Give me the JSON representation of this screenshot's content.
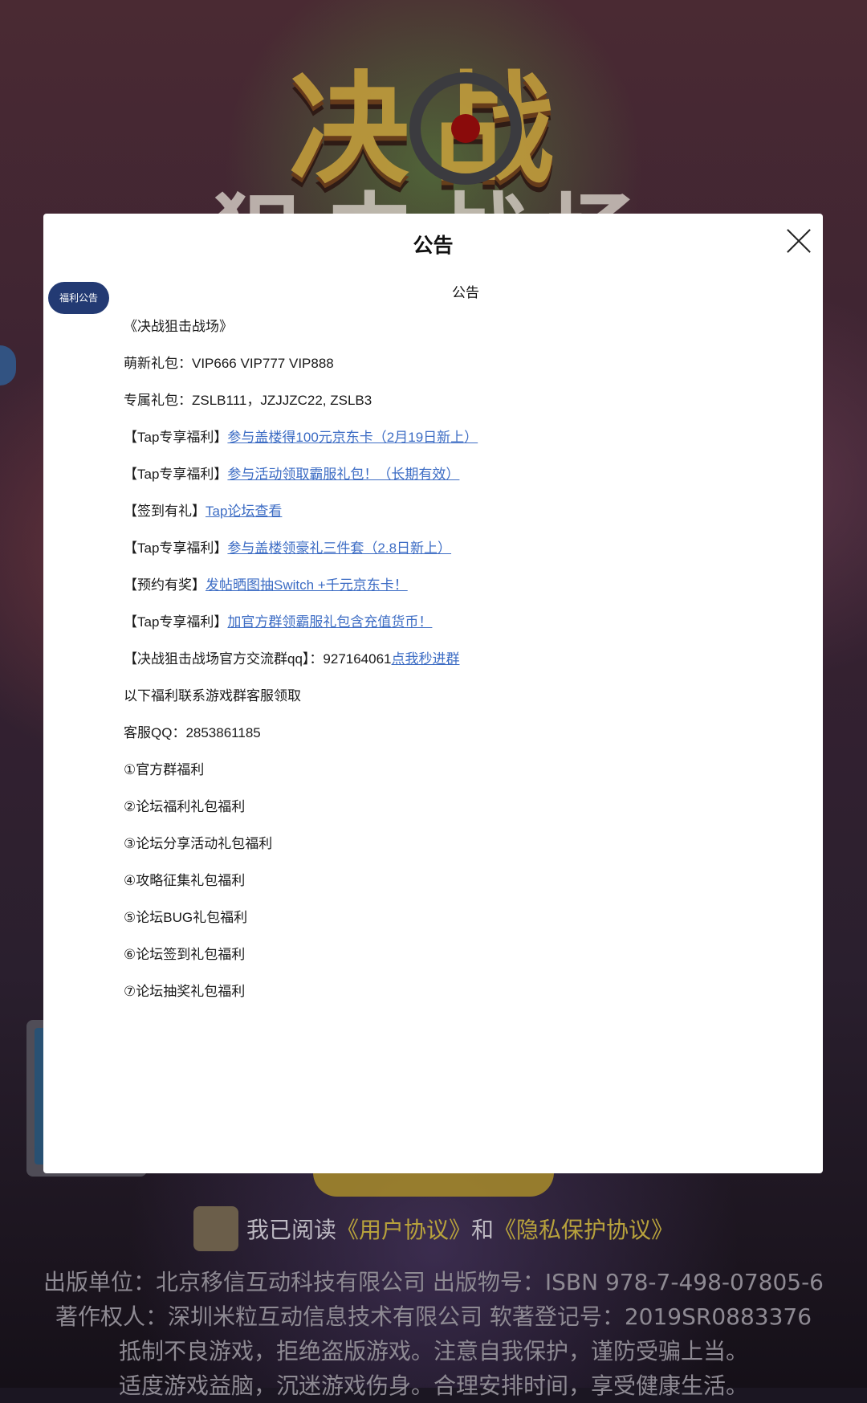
{
  "background": {
    "game_title_top": "决战",
    "game_title_bottom": "狙击战场"
  },
  "modal": {
    "title": "公告",
    "close_icon": "close-icon",
    "side_tab_label": "福利公告",
    "notice_heading": "公告",
    "lines": [
      {
        "text": "《决战狙击战场》",
        "link": ""
      },
      {
        "text": "萌新礼包：VIP666 VIP777 VIP888",
        "link": ""
      },
      {
        "text": "专属礼包：ZSLB111，JZJJZC22, ZSLB3",
        "link": ""
      },
      {
        "text": "【Tap专享福利】",
        "link": "参与盖楼得100元京东卡（2月19日新上）"
      },
      {
        "text": "【Tap专享福利】",
        "link": "参与活动领取霸服礼包！（长期有效）"
      },
      {
        "text": "【签到有礼】",
        "link": "Tap论坛查看"
      },
      {
        "text": "【Tap专享福利】",
        "link": "参与盖楼领豪礼三件套（2.8日新上）"
      },
      {
        "text": "【预约有奖】",
        "link": "发帖晒图抽Switch +千元京东卡！"
      },
      {
        "text": "【Tap专享福利】",
        "link": "加官方群领霸服礼包含充值货币！"
      },
      {
        "text": "【决战狙击战场官方交流群qq】：927164061",
        "link": "点我秒进群"
      },
      {
        "text": "以下福利联系游戏群客服领取",
        "link": ""
      },
      {
        "text": "客服QQ：2853861185",
        "link": ""
      },
      {
        "text": "①官方群福利",
        "link": ""
      },
      {
        "text": "②论坛福利礼包福利",
        "link": ""
      },
      {
        "text": "③论坛分享活动礼包福利",
        "link": ""
      },
      {
        "text": "④攻略征集礼包福利",
        "link": ""
      },
      {
        "text": "⑤论坛BUG礼包福利",
        "link": ""
      },
      {
        "text": "⑥论坛签到礼包福利",
        "link": ""
      },
      {
        "text": "⑦论坛抽奖礼包福利",
        "link": ""
      }
    ]
  },
  "agreement": {
    "prefix": "我已阅读",
    "user_agreement": "《用户协议》",
    "and": "和",
    "privacy_policy": "《隐私保护协议》"
  },
  "footer": {
    "line1": "出版单位：北京移信互动科技有限公司  出版物号：ISBN 978-7-498-07805-6",
    "line2": "著作权人：深圳米粒互动信息技术有限公司 软著登记号：2019SR0883376",
    "line3": "抵制不良游戏，拒绝盗版游戏。注意自我保护，谨防受骗上当。",
    "line4": "适度游戏益脑，沉迷游戏伤身。合理安排时间，享受健康生活。"
  },
  "colors": {
    "link": "#3c6cc4",
    "badge": "#233a73",
    "agreement_link": "#b8a23c"
  }
}
